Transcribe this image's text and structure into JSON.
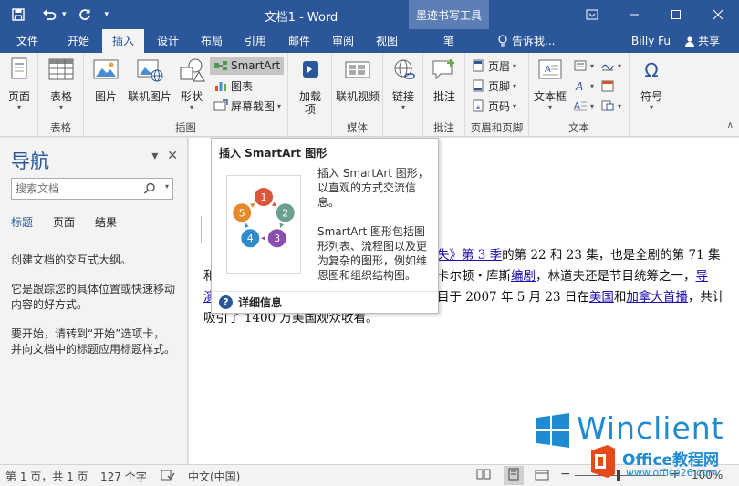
{
  "window": {
    "title": "文档1 - Word",
    "context_tab": "墨迹书写工具"
  },
  "tabs": [
    "文件",
    "开始",
    "插入",
    "设计",
    "布局",
    "引用",
    "邮件",
    "审阅",
    "视图",
    "笔"
  ],
  "active_tab": "插入",
  "tell_me": "告诉我...",
  "user": "Billy Fu",
  "share": "共享",
  "ribbon": {
    "pages": {
      "btn": "页面",
      "label": ""
    },
    "tables": {
      "btn": "表格",
      "label": "表格"
    },
    "illustrations": {
      "label": "插图",
      "picture": "图片",
      "online_picture": "联机图片",
      "shapes": "形状",
      "smartart": "SmartArt",
      "chart": "图表",
      "screenshot": "屏幕截图"
    },
    "addins": {
      "btn1": "加载",
      "btn2": "项",
      "label": ""
    },
    "media": {
      "btn": "联机视频",
      "label": "媒体"
    },
    "links": {
      "btn": "链接",
      "label": ""
    },
    "comments": {
      "btn": "批注",
      "label": "批注"
    },
    "header_footer": {
      "header": "页眉",
      "footer": "页脚",
      "page_number": "页码",
      "label": "页眉和页脚"
    },
    "text": {
      "btn": "文本框",
      "label": "文本"
    },
    "symbols": {
      "btn": "符号",
      "label": ""
    }
  },
  "nav": {
    "title": "导航",
    "search_placeholder": "搜索文档",
    "tabs": [
      "标题",
      "页面",
      "结果"
    ],
    "p1": "创建文档的交互式大纲。",
    "p2": "它是跟踪您的具体位置或快速移动内容的好方式。",
    "p3": "要开始，请转到“开始”选项卡，并向文档中的标题应用标题样式。"
  },
  "doc": {
    "l1a": "失》",
    "l1b": "第 3 季",
    "l1c": "的第 22 和 23 集，也是全剧的第 71 集",
    "l2pre": "和",
    "l2a": "卡尔顿・库斯",
    "l2b": "编剧",
    "l2c": "，林道夫还是节目统筹之一，",
    "l2d": "导",
    "l3pre": "演",
    "l3a": "目于 2007 年 5 月 23 日在",
    "l3b": "美国",
    "l3c": "和",
    "l3d": "加拿大首播",
    "l3e": "，共计",
    "l4": "吸引了 1400 万美国观众收看。"
  },
  "tooltip": {
    "title": "插入 SmartArt 图形",
    "desc1": "插入 SmartArt 图形，以直观的方式交流信息。",
    "desc2": "SmartArt 图形包括图形列表、流程图以及更为复杂的图形，例如维恩图和组织结构图。",
    "more": "详细信息",
    "cycle": [
      "1",
      "2",
      "3",
      "4",
      "5"
    ]
  },
  "status": {
    "page": "第 1 页，共 1 页",
    "words": "127 个字",
    "lang": "中文(中国)",
    "zoom": "100%"
  },
  "watermark": {
    "brand": "Winclient",
    "sub": "Office教程网",
    "url": "www.office26.com"
  },
  "colors": {
    "word_blue": "#2b579a",
    "cycle": [
      "#d9563a",
      "#6ba08f",
      "#8a4fae",
      "#2e8bcc",
      "#e58a2c"
    ]
  }
}
